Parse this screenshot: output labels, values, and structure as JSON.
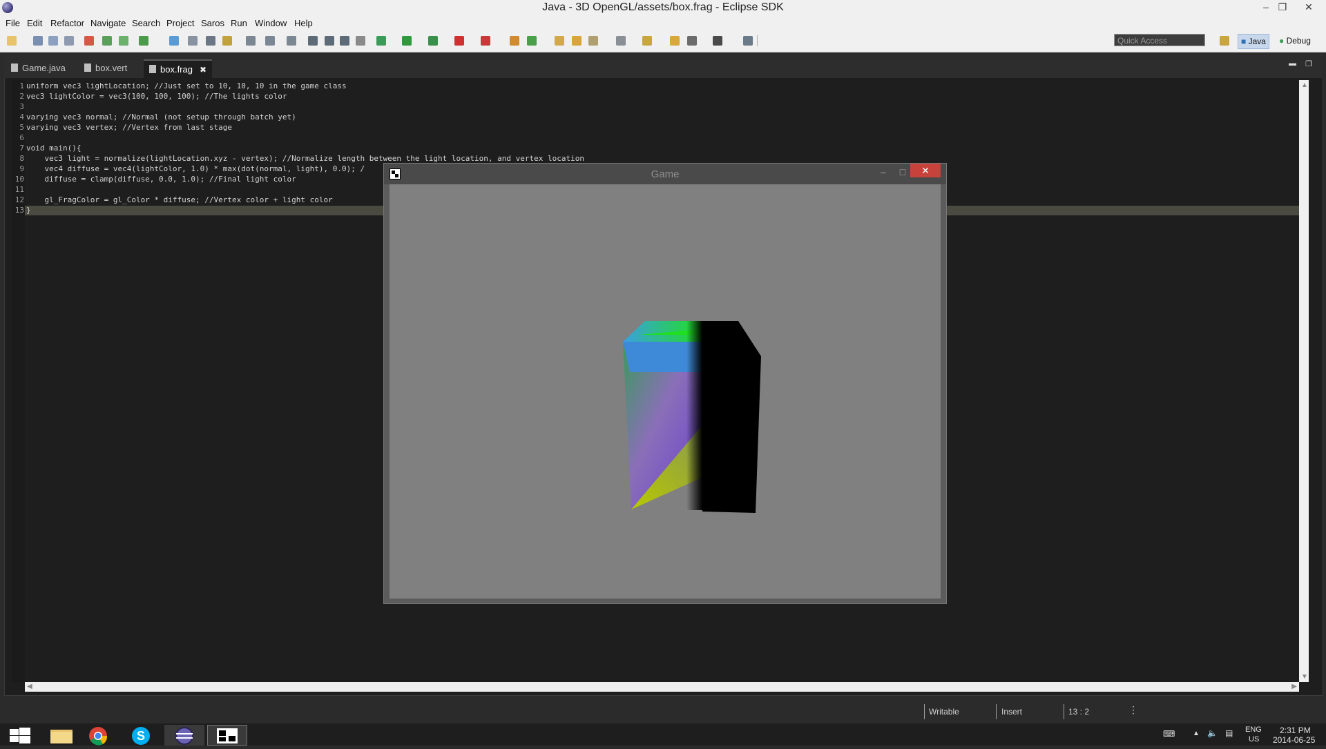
{
  "window": {
    "title": "Java - 3D OpenGL/assets/box.frag - Eclipse SDK"
  },
  "menu": [
    "File",
    "Edit",
    "Refactor",
    "Navigate",
    "Search",
    "Project",
    "Saros",
    "Run",
    "Window",
    "Help"
  ],
  "toolbar": {
    "quick_access_placeholder": "Quick Access",
    "perspectives": [
      "Java",
      "Debug"
    ]
  },
  "tabs": [
    {
      "label": "Game.java",
      "active": false
    },
    {
      "label": "box.vert",
      "active": false
    },
    {
      "label": "box.frag",
      "active": true
    }
  ],
  "editor": {
    "lines": [
      {
        "n": "1",
        "text": "uniform vec3 lightLocation; //Just set to 10, 10, 10 in the game class"
      },
      {
        "n": "2",
        "text": "vec3 lightColor = vec3(100, 100, 100); //The lights color"
      },
      {
        "n": "3",
        "text": ""
      },
      {
        "n": "4",
        "text": "varying vec3 normal; //Normal (not setup through batch yet)"
      },
      {
        "n": "5",
        "text": "varying vec3 vertex; //Vertex from last stage"
      },
      {
        "n": "6",
        "text": ""
      },
      {
        "n": "7",
        "text": "void main(){"
      },
      {
        "n": "8",
        "text": "    vec3 light = normalize(lightLocation.xyz - vertex); //Normalize length between the light location, and vertex location"
      },
      {
        "n": "9",
        "text": "    vec4 diffuse = vec4(lightColor, 1.0) * max(dot(normal, light), 0.0); /"
      },
      {
        "n": "10",
        "text": "    diffuse = clamp(diffuse, 0.0, 1.0); //Final light color"
      },
      {
        "n": "11",
        "text": ""
      },
      {
        "n": "12",
        "text": "    gl_FragColor = gl_Color * diffuse; //Vertex color + light color"
      },
      {
        "n": "13",
        "text": "}"
      }
    ]
  },
  "status": {
    "mode": "Writable",
    "insert": "Insert",
    "position": "13 : 2"
  },
  "game_window": {
    "title": "Game"
  },
  "taskbar": {
    "apps": [
      "windows-start",
      "file-explorer",
      "chrome",
      "skype",
      "eclipse",
      "game"
    ],
    "lang": "ENG",
    "region": "US",
    "time": "2:31 PM",
    "date": "2014-06-25"
  }
}
